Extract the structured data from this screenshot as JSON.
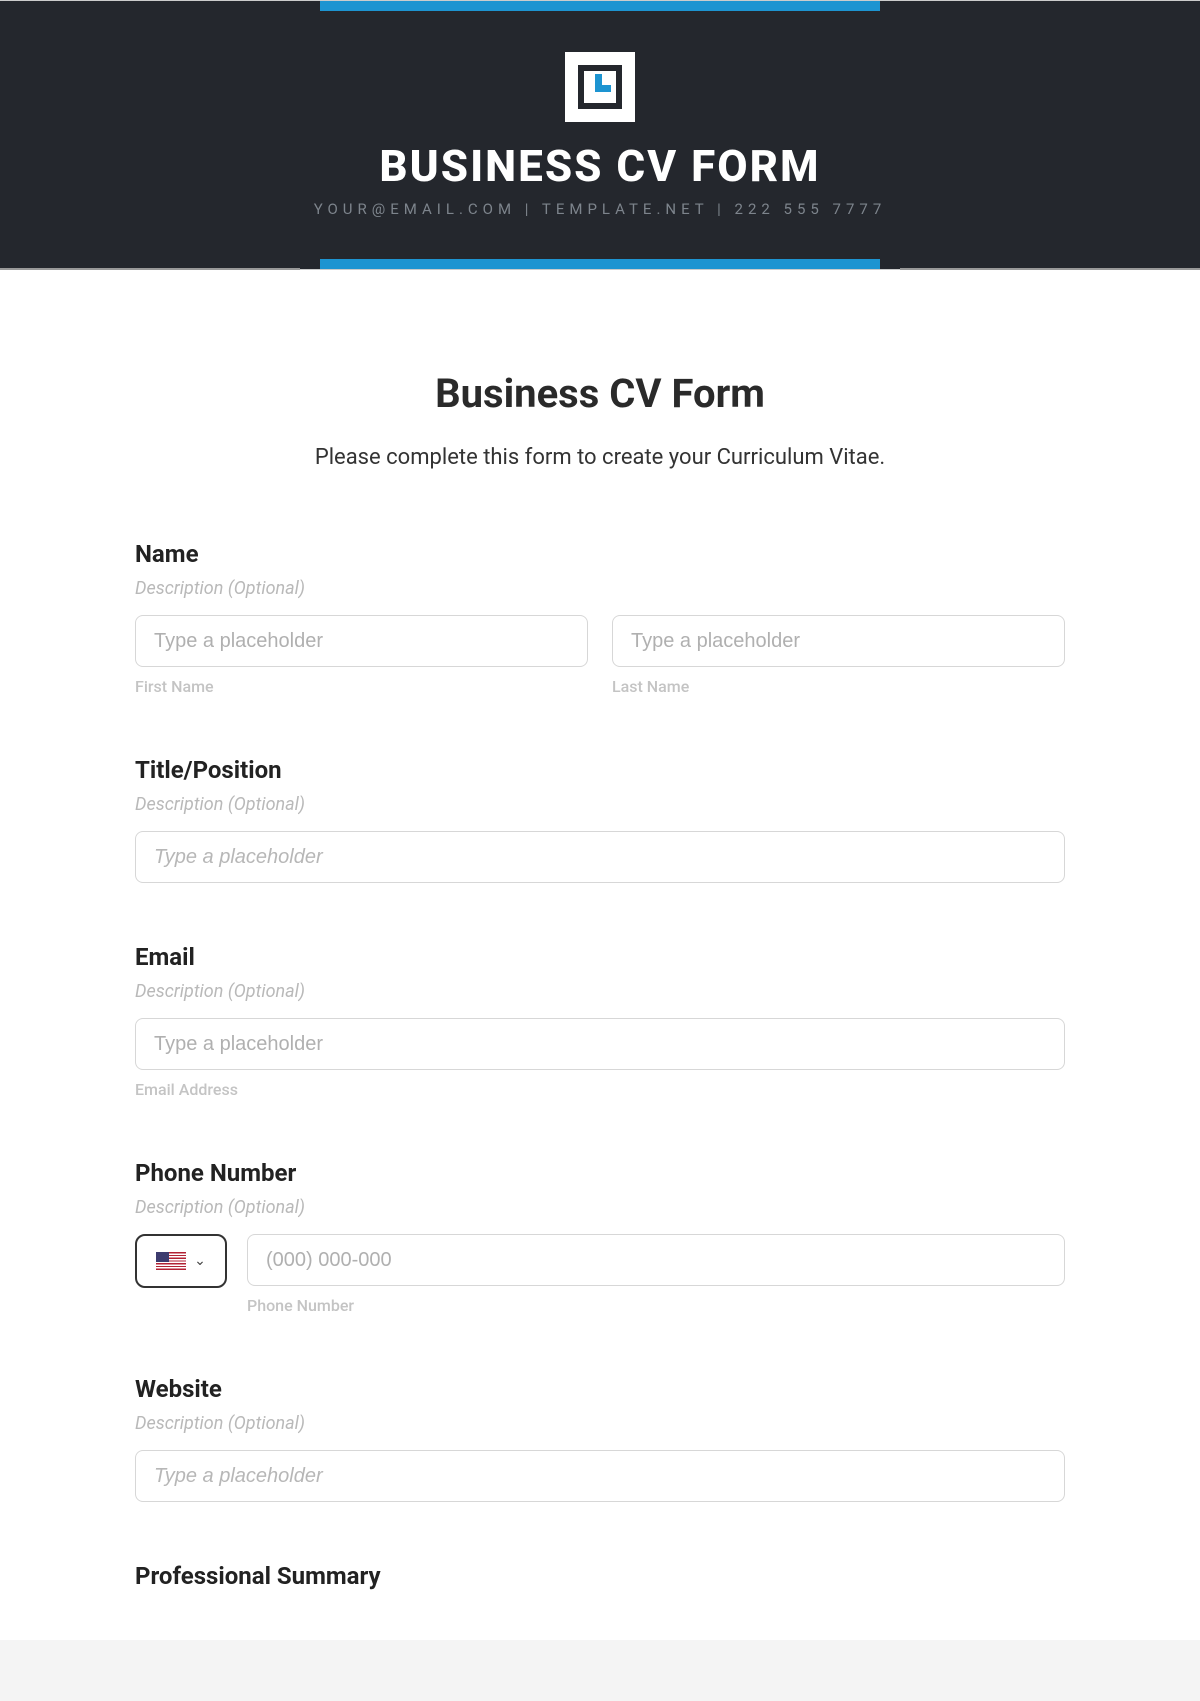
{
  "banner": {
    "title": "BUSINESS CV FORM",
    "subtitle": "YOUR@EMAIL.COM | TEMPLATE.NET | 222 555 7777"
  },
  "form": {
    "title": "Business CV Form",
    "intro": "Please complete this form to create your Curriculum Vitae.",
    "desc_placeholder": "Description (Optional)",
    "fields": {
      "name": {
        "label": "Name",
        "first_placeholder": "Type a placeholder",
        "first_sub": "First Name",
        "last_placeholder": "Type a placeholder",
        "last_sub": "Last Name"
      },
      "title": {
        "label": "Title/Position",
        "placeholder": "Type a placeholder"
      },
      "email": {
        "label": "Email",
        "placeholder": "Type a placeholder",
        "sub": "Email Address"
      },
      "phone": {
        "label": "Phone Number",
        "placeholder": "(000) 000-000",
        "sub": "Phone Number"
      },
      "website": {
        "label": "Website",
        "placeholder": "Type a placeholder"
      },
      "summary": {
        "label": "Professional Summary"
      }
    }
  }
}
